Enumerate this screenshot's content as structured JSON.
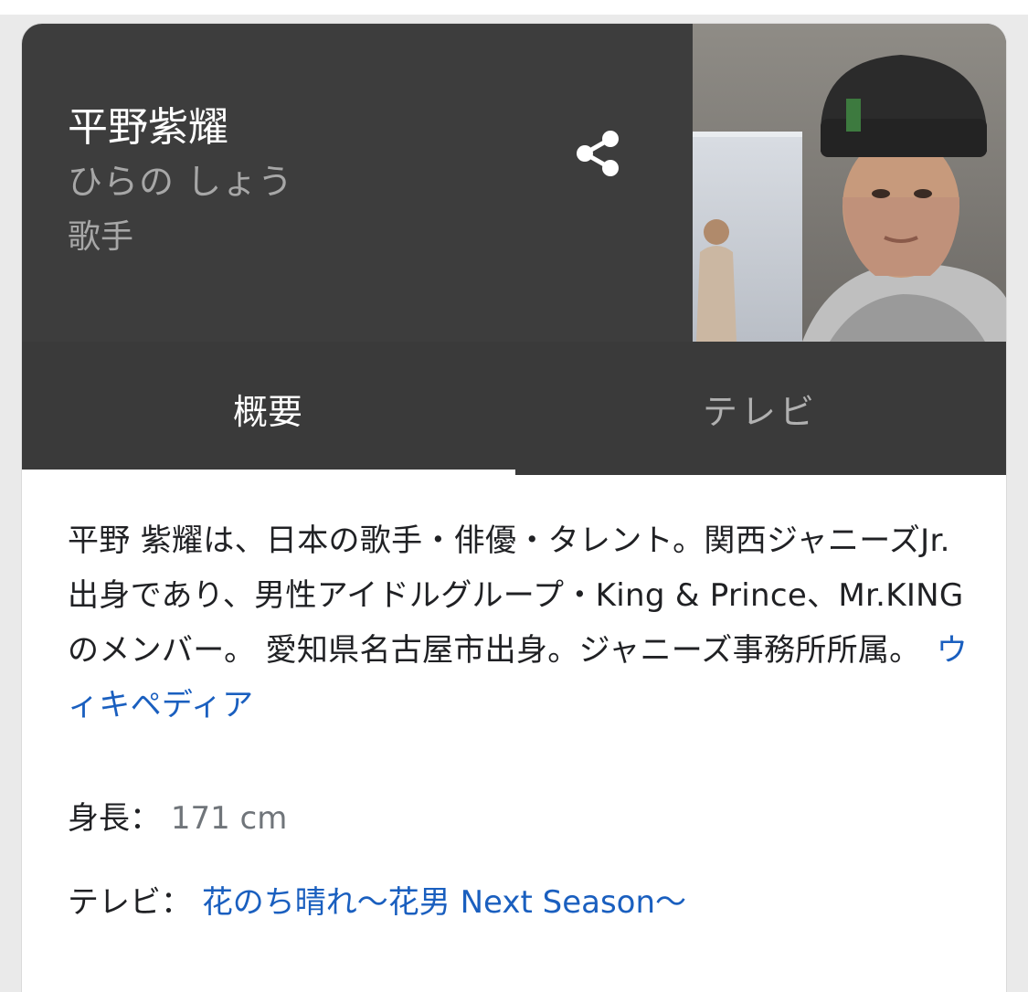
{
  "header": {
    "name": "平野紫耀",
    "reading": "ひらの しょう",
    "occupation": "歌手"
  },
  "tabs": [
    {
      "label": "概要",
      "selected": true
    },
    {
      "label": "テレビ",
      "selected": false
    }
  ],
  "description": {
    "text": "平野 紫耀は、日本の歌手・俳優・タレント。関西ジャニーズJr.出身であり、男性アイドルグループ・King & Prince、Mr.KINGのメンバー。 愛知県名古屋市出身。ジャニーズ事務所所属。",
    "source_link": "ウィキペディア"
  },
  "facts": {
    "height_label": "身長",
    "height_value": "171 cm",
    "tv_label": "テレビ",
    "tv_value": "花のち晴れ～花男 Next Season～",
    "separator": "："
  },
  "colors": {
    "header_bg": "#3d3d3d",
    "tab_bg": "#3a3a3a",
    "link": "#1a5fbf"
  }
}
